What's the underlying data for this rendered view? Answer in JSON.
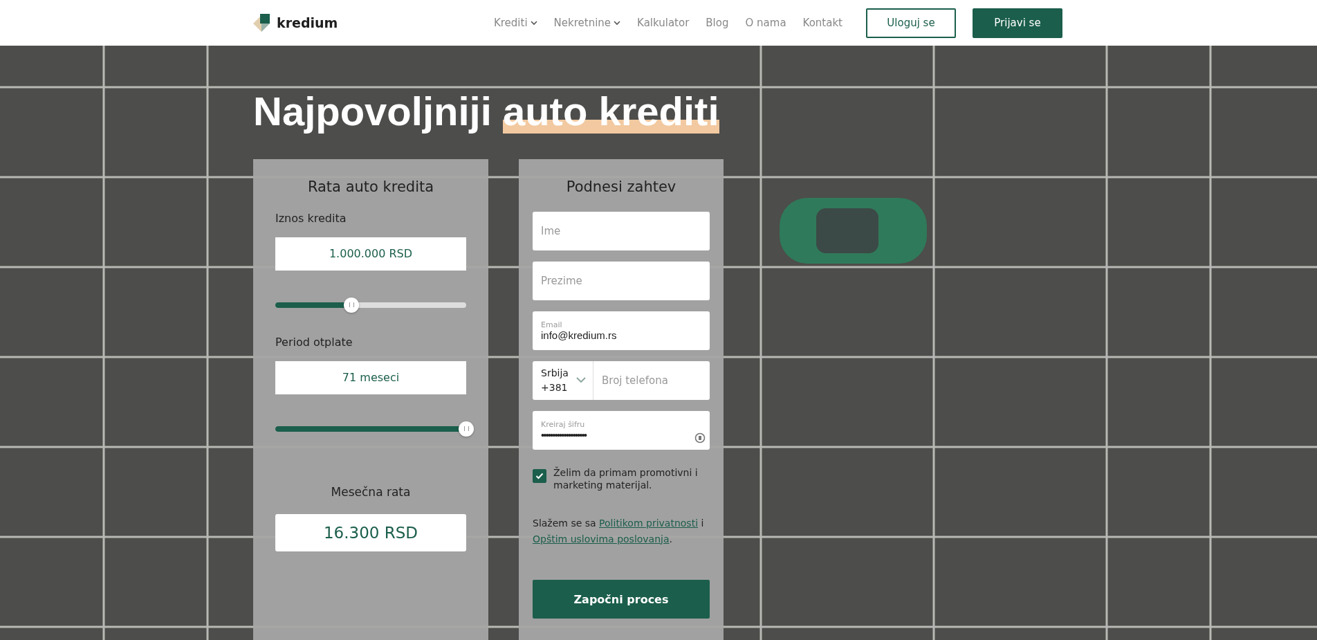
{
  "header": {
    "logo": "kredium",
    "nav": [
      {
        "label": "Krediti",
        "dropdown": true
      },
      {
        "label": "Nekretnine",
        "dropdown": true
      },
      {
        "label": "Kalkulator",
        "dropdown": false
      },
      {
        "label": "Blog",
        "dropdown": false
      },
      {
        "label": "O nama",
        "dropdown": false
      },
      {
        "label": "Kontakt",
        "dropdown": false
      }
    ],
    "login_button": "Uloguj se",
    "signup_button": "Prijavi se"
  },
  "hero": {
    "title_start": "Najpovoljniji",
    "title_highlight": "auto krediti"
  },
  "calculator": {
    "title": "Rata auto kredita",
    "sliders": [
      {
        "label": "Iznos kredita",
        "value": "1.000.000 RSD",
        "level": 0.4
      },
      {
        "label": "Period otplate",
        "value": "71 meseci",
        "level": 1.0
      }
    ],
    "result_label": "Mesečna rata",
    "result_value": "16.300 RSD"
  },
  "form": {
    "title": "Podnesi zahtev",
    "first_name": {
      "placeholder": "Ime"
    },
    "last_name": {
      "placeholder": "Prezime"
    },
    "email": {
      "placeholder": "Email",
      "value": "info@kredium.rs"
    },
    "country_select": {
      "country": "Srbija",
      "code": "+381"
    },
    "phone": {
      "placeholder": "Broj telefona"
    },
    "password": {
      "placeholder": "Kreiraj šifru",
      "value": "••••••••••••••••••••"
    },
    "consent": {
      "checked": true,
      "label": "Želim da primam promotivni i marketing materijal."
    },
    "terms_start": "Slažem se sa",
    "terms_link_1": "Politikom privatnosti",
    "terms_mid": "i",
    "terms_link_2": "Opštim uslovima poslovanja",
    "terms_end": ".",
    "submit_button": "Započni proces"
  }
}
